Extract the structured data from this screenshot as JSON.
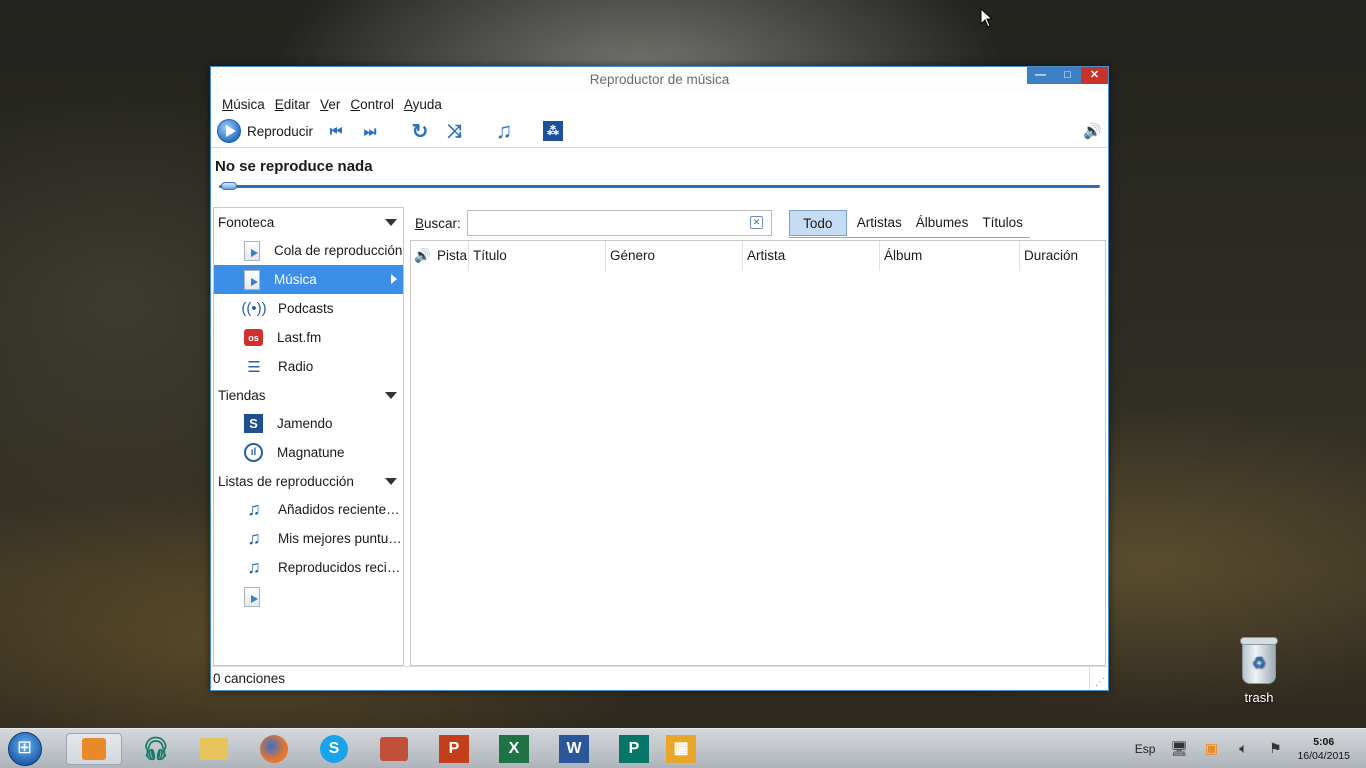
{
  "window": {
    "title": "Reproductor de música",
    "controls": {
      "minimize": "—",
      "maximize": "□",
      "close": "✕"
    }
  },
  "menu": [
    {
      "u": "M",
      "rest": "úsica"
    },
    {
      "u": "E",
      "rest": "ditar"
    },
    {
      "u": "V",
      "rest": "er"
    },
    {
      "u": "C",
      "rest": "ontrol"
    },
    {
      "u": "A",
      "rest": "yuda"
    }
  ],
  "toolbar": {
    "play_label": "Reproducir",
    "icons": [
      "previous-icon",
      "next-icon",
      "repeat-icon",
      "shuffle-icon",
      "music-note-icon",
      "visualizer-icon"
    ],
    "glyphs": {
      "previous": "⏮",
      "next": "⏭",
      "repeat": "↻",
      "shuffle": "⤨",
      "note": "♫",
      "visualizer": "⁂",
      "volume": "🔊"
    }
  },
  "now_playing": "No se reproduce nada",
  "sidebar": {
    "sections": [
      {
        "title": "Fonoteca",
        "items": [
          {
            "label": "Cola de reproducción",
            "icon": "play-queue-icon"
          },
          {
            "label": "Música",
            "icon": "music-note-icon",
            "selected": true
          },
          {
            "label": "Podcasts",
            "icon": "podcast-icon"
          },
          {
            "label": "Last.fm",
            "icon": "lastfm-icon"
          },
          {
            "label": "Radio",
            "icon": "radio-icon"
          }
        ]
      },
      {
        "title": "Tiendas",
        "items": [
          {
            "label": "Jamendo",
            "icon": "jamendo-icon"
          },
          {
            "label": "Magnatune",
            "icon": "magnatune-icon"
          }
        ]
      },
      {
        "title": "Listas de reproducción",
        "items": [
          {
            "label": "Añadidos recientemente",
            "icon": "playlist-icon"
          },
          {
            "label": "Mis mejores puntuaciones",
            "icon": "playlist-icon"
          },
          {
            "label": "Reproducidos recientemente",
            "icon": "playlist-icon"
          },
          {
            "label": "",
            "icon": "play-queue-icon"
          }
        ]
      }
    ]
  },
  "search": {
    "label_u": "B",
    "label_rest": "uscar:",
    "value": "",
    "placeholder": ""
  },
  "filters": [
    "Todo",
    "Artistas",
    "Álbumes",
    "Títulos"
  ],
  "active_filter": "Todo",
  "columns": [
    "Pista",
    "Título",
    "Género",
    "Artista",
    "Álbum",
    "Duración"
  ],
  "rows": [],
  "status": "0 canciones",
  "desktop": {
    "trash_label": "trash"
  },
  "taskbar": {
    "language": "Esp",
    "time": "5:06",
    "date": "16/04/2015",
    "apps": [
      "music-player",
      "headphones",
      "file-explorer",
      "firefox",
      "skype",
      "video-maker",
      "powerpoint",
      "excel",
      "word",
      "publisher",
      "project"
    ]
  },
  "colors": {
    "accent": "#3d8ee8",
    "window_border": "#4a90c8",
    "close": "#c7342b"
  }
}
